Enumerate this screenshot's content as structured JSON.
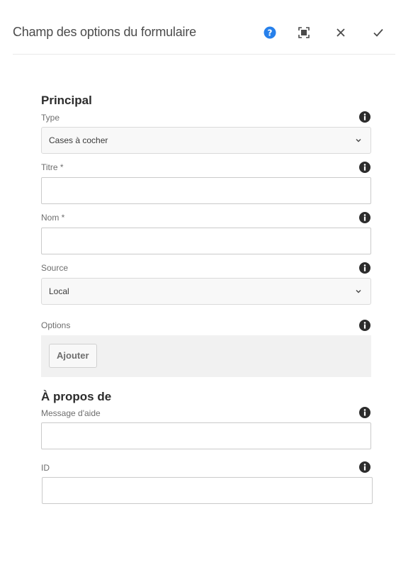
{
  "header": {
    "title": "Champ des options du formulaire",
    "help_color": "#2680eb"
  },
  "principal": {
    "heading": "Principal",
    "type": {
      "label": "Type",
      "value": "Cases à cocher"
    },
    "titre": {
      "label": "Titre *",
      "value": ""
    },
    "nom": {
      "label": "Nom *",
      "value": ""
    },
    "source": {
      "label": "Source",
      "value": "Local"
    },
    "options": {
      "label": "Options",
      "add_button": "Ajouter"
    }
  },
  "about": {
    "heading": "À propos de",
    "help_message": {
      "label": "Message d'aide",
      "value": ""
    },
    "id": {
      "label": "ID",
      "value": ""
    }
  }
}
